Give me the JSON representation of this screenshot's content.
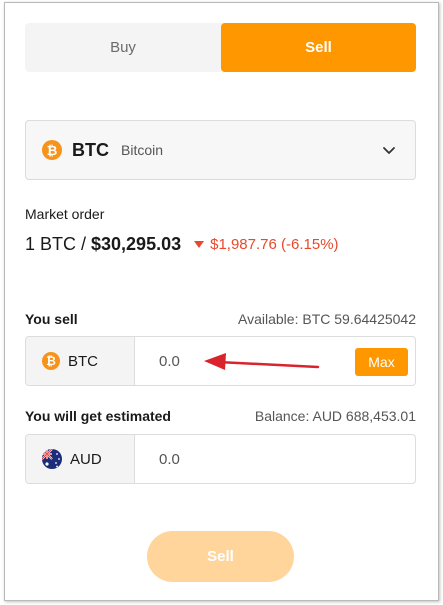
{
  "toggle": {
    "buy_label": "Buy",
    "sell_label": "Sell",
    "active": "Sell"
  },
  "asset": {
    "icon": "bitcoin-icon",
    "symbol": "BTC",
    "name": "Bitcoin"
  },
  "market": {
    "label": "Market order",
    "unit": "1 BTC /",
    "price": "$30,295.03",
    "change": "$1,987.76 (-6.15%)",
    "change_direction": "down"
  },
  "sell_field": {
    "label": "You sell",
    "available": "Available: BTC 59.64425042",
    "currency": "BTC",
    "icon": "bitcoin-icon",
    "value": "0.0",
    "max_label": "Max"
  },
  "get_field": {
    "label": "You will get estimated",
    "balance": "Balance: AUD 688,453.01",
    "currency": "AUD",
    "icon": "australia-flag-icon",
    "value": "0.0"
  },
  "submit": {
    "label": "Sell"
  },
  "colors": {
    "accent": "#ff9800",
    "accent_disabled": "#ffd59b",
    "negative": "#e8492c",
    "annotation_arrow": "#d9232d",
    "bitcoin": "#f7931a"
  }
}
